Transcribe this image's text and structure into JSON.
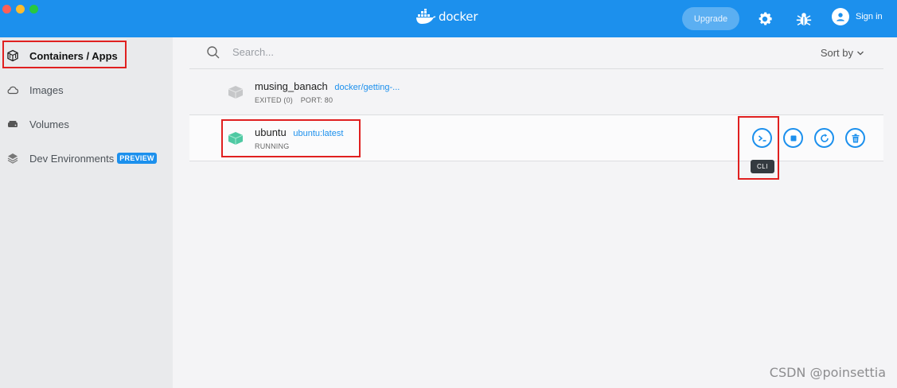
{
  "titlebar": {
    "app_name": "docker",
    "upgrade_label": "Upgrade",
    "signin_label": "Sign in",
    "bg_color": "#1c90ed"
  },
  "sidebar": {
    "items": [
      {
        "label": "Containers / Apps",
        "icon": "containers-icon",
        "active": true
      },
      {
        "label": "Images",
        "icon": "cloud-icon",
        "active": false
      },
      {
        "label": "Volumes",
        "icon": "volumes-icon",
        "active": false
      },
      {
        "label": "Dev Environments",
        "icon": "dev-env-icon",
        "active": false,
        "badge": "PREVIEW"
      }
    ]
  },
  "search": {
    "placeholder": "Search...",
    "value": ""
  },
  "sort": {
    "label": "Sort by"
  },
  "containers": [
    {
      "name": "musing_banach",
      "image": "docker/getting-...",
      "status": "EXITED (0)",
      "port": "PORT: 80",
      "running": false
    },
    {
      "name": "ubuntu",
      "image": "ubuntu:latest",
      "status": "RUNNING",
      "port": "",
      "running": true
    }
  ],
  "actions": {
    "tooltip": "CLI",
    "buttons": [
      "cli-icon",
      "stop-icon",
      "restart-icon",
      "delete-icon"
    ]
  },
  "watermark": "CSDN @poinsettia",
  "colors": {
    "accent": "#1c90ed",
    "running_cube": "#4fc9a3",
    "exited_cube": "#c6c7c9",
    "highlight": "#e02020"
  }
}
